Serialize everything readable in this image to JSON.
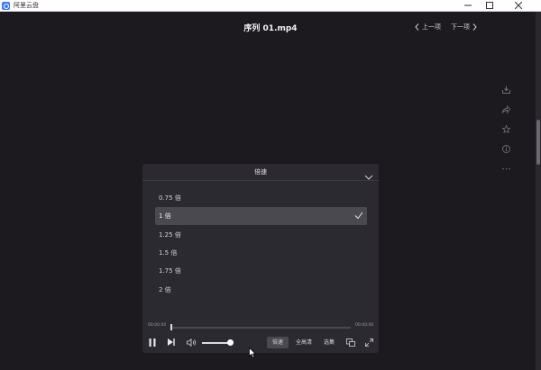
{
  "window": {
    "app_title": "阿里云盘",
    "icons": [
      "app-logo-icon",
      "minimize-icon",
      "maximize-icon",
      "close-icon"
    ]
  },
  "header": {
    "file_title": "序列 01.mp4",
    "prev_label": "上一项",
    "next_label": "下一项"
  },
  "side_toolbar": {
    "icons": [
      "download-icon",
      "share-icon",
      "star-icon",
      "info-icon",
      "more-icon"
    ]
  },
  "speed_panel": {
    "title": "倍速",
    "options": [
      "0.75 倍",
      "1 倍",
      "1.25 倍",
      "1.5 倍",
      "1.75 倍",
      "2 倍"
    ],
    "selected_index": 1
  },
  "player": {
    "current_time": "00:00:00",
    "total_time": "00:00:00",
    "progress_fraction": 0,
    "volume_fraction": 1,
    "speed_label": "倍速",
    "quality_label": "全高清",
    "episodes_label": "选集"
  },
  "colors": {
    "background": "#1c1a1f",
    "panel": "#2b2a30",
    "selected_row": "#4a4950",
    "accent": "#3c7cf5"
  }
}
